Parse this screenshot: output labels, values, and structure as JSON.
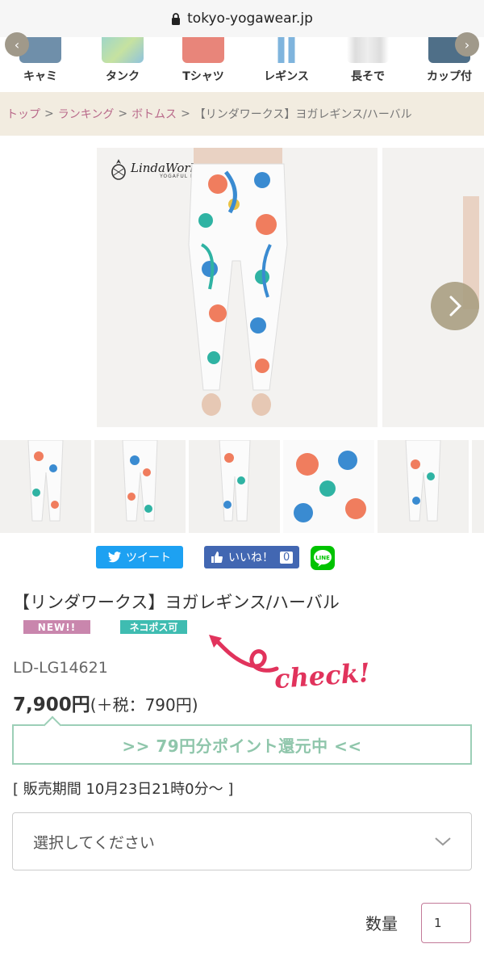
{
  "browser": {
    "url": "tokyo-yogawear.jp"
  },
  "categories": [
    {
      "label": "キャミ",
      "color": "#6f8faa"
    },
    {
      "label": "タンク",
      "color": "#9fd6c9"
    },
    {
      "label": "Tシャツ",
      "color": "#e8857a"
    },
    {
      "label": "レギンス",
      "color": "#7fb4dd"
    },
    {
      "label": "長そで",
      "color": "#dddddd"
    },
    {
      "label": "カップ付",
      "color": "#4f6f88"
    }
  ],
  "breadcrumb": {
    "items": [
      "トップ",
      "ランキング",
      "ボトムス"
    ],
    "separator": ">",
    "current": "【リンダワークス】ヨガレギンス/ハーバル"
  },
  "gallery": {
    "brand_name": "LindaWorks",
    "brand_sub": "YOGAFUL LIFE"
  },
  "social": {
    "tweet_label": "ツイート",
    "like_label": "いいね！",
    "like_count": "0",
    "line_label": "LINE"
  },
  "product": {
    "title": "【リンダワークス】ヨガレギンス/ハーバル",
    "badge_new": "NEW!!",
    "badge_neko": "ネコポス可",
    "annotation": "check!",
    "sku": "LD-LG14621",
    "price": "7,900円",
    "tax": "(＋税：790円)",
    "points": ">> 79円分ポイント還元中 <<",
    "period": "[ 販売期間  10月23日21時0分〜 ]",
    "select_placeholder": "選択してください",
    "qty_label": "数量",
    "qty_value": "1"
  },
  "colors": {
    "breadcrumb_bg": "#f2ece0",
    "breadcrumb_link": "#b9698a",
    "points_border": "#9ccfb7",
    "badge_new": "#c986ad",
    "badge_neko": "#3fbcb1",
    "annotation": "#e1335c"
  }
}
